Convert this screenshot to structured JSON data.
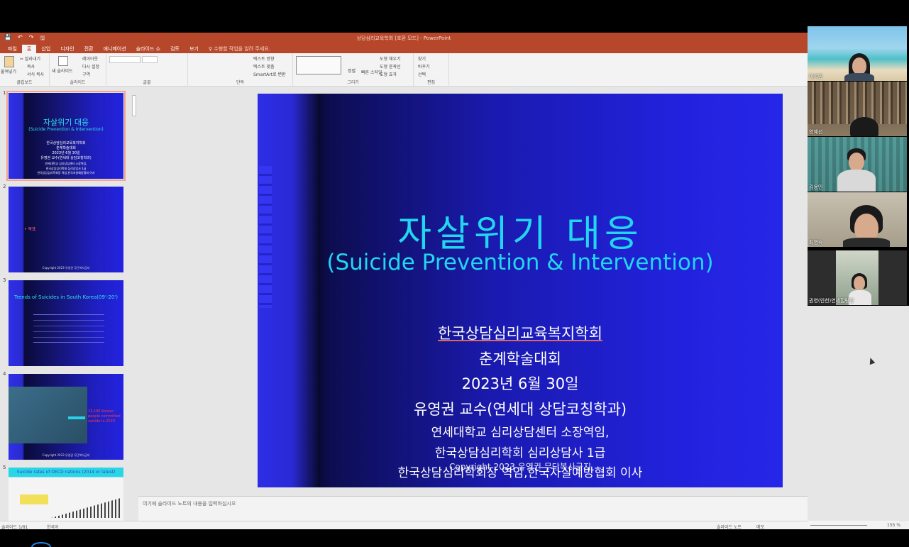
{
  "window": {
    "title": "상담심리교육학회 [호환 모드] - PowerPoint",
    "qat": [
      "💾",
      "↶",
      "↷",
      "🖫"
    ]
  },
  "tabs": [
    "파일",
    "홈",
    "삽입",
    "디자인",
    "전환",
    "애니메이션",
    "슬라이드 쇼",
    "검토",
    "보기",
    "♀ 수행할 작업을 알려 주세요."
  ],
  "ribbon": {
    "clipboard": {
      "paste": "붙여넣기",
      "cut": "✂ 잘라내기",
      "copy": "복사",
      "format": "서식 복사",
      "label": "클립보드"
    },
    "slides": {
      "new": "새 슬라이드",
      "layout": "레이아웃",
      "reset": "다시 설정",
      "section": "구역",
      "label": "슬라이드"
    },
    "font": {
      "label": "글꼴"
    },
    "paragraph": {
      "direction": "텍스트 방향",
      "align": "텍스트 맞춤",
      "smartart": "SmartArt로 변환",
      "label": "단락"
    },
    "drawing": {
      "arrange": "정렬",
      "quick": "빠른 스타일",
      "fill": "도형 채우기",
      "outline": "도형 윤곽선",
      "effect": "도형 효과",
      "label": "그리기"
    },
    "editing": {
      "find": "찾기",
      "replace": "바꾸기",
      "select": "선택",
      "label": "편집"
    }
  },
  "thumbnails": [
    {
      "num": "1",
      "title": "자살위기 대응",
      "subtitle": "(Suicide Prevention & Intervention)",
      "lines": [
        "한국상담심리교육복지학회",
        "춘계학술대회",
        "2023년 6월 30일",
        "유영권 교수(연세대 상담코칭학과)",
        "연세대학교 심리상담센터 소장역임,",
        "한국상담심리학회 심리상담사 1급",
        "한국상담심리학회장 역임,한국자살예방협회 이사"
      ]
    },
    {
      "num": "2",
      "text": "• 목표",
      "copy": "Copyright 2023 유영권 무단복사금지"
    },
    {
      "num": "3",
      "title": "Trends of Suicides in South Korea(09'-20')"
    },
    {
      "num": "4",
      "stat": "13,195 Korean people committed suicide in 2020",
      "copy": "Copyright 2023 유영권 무단복사금지"
    },
    {
      "num": "5",
      "title": "Suicide rates of OECD nations (2014 or latest)"
    }
  ],
  "slide": {
    "title": "자살위기 대응",
    "subtitle": "(Suicide Prevention & Intervention)",
    "lines": [
      "한국상담심리교육복지학회",
      "춘계학술대회",
      "2023년 6월 30일",
      "유영권 교수(연세대 상담코칭학과)",
      "연세대학교 심리상담센터 소장역임,",
      "한국상담심리학회 심리상담사 1급",
      "한국상담심리학회장 역임,한국자살예방협회 이사"
    ],
    "copyright": "Copyright 2023 유영권 무단복사금지"
  },
  "notes": {
    "placeholder": "여기에 슬라이드 노트의 내용을 입력하십시오"
  },
  "status": {
    "slide": "슬라이드 1/81",
    "lang": "한국어",
    "notes": "슬라이드 노트",
    "comments": "메모",
    "zoom": "155 %"
  },
  "participants": [
    {
      "name": "이지민"
    },
    {
      "name": "양혜선"
    },
    {
      "name": "김용민"
    },
    {
      "name": "최영숙"
    },
    {
      "name": "권영(인천)연세힐링랑"
    }
  ]
}
